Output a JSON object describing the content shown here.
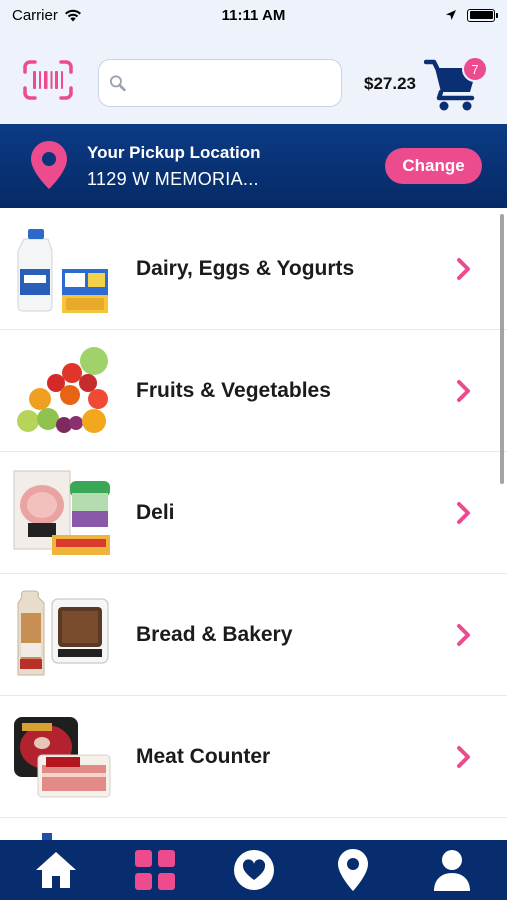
{
  "status_bar": {
    "carrier": "Carrier",
    "time": "11:11 AM"
  },
  "header": {
    "search_placeholder": "",
    "cart_total": "$27.23",
    "cart_count": "7"
  },
  "pickup": {
    "title": "Your Pickup Location",
    "address": "1129 W MEMORIA...",
    "change_label": "Change"
  },
  "categories": [
    {
      "label": "Dairy, Eggs & Yogurts",
      "icon": "dairy-image"
    },
    {
      "label": "Fruits & Vegetables",
      "icon": "produce-image"
    },
    {
      "label": "Deli",
      "icon": "deli-image"
    },
    {
      "label": "Bread & Bakery",
      "icon": "bakery-image"
    },
    {
      "label": "Meat Counter",
      "icon": "meat-image"
    }
  ],
  "tabs": [
    {
      "icon": "home-icon",
      "active": false
    },
    {
      "icon": "categories-grid-icon",
      "active": true
    },
    {
      "icon": "favorites-heart-icon",
      "active": false
    },
    {
      "icon": "location-pin-icon",
      "active": false
    },
    {
      "icon": "account-person-icon",
      "active": false
    }
  ],
  "colors": {
    "accent": "#ec4b8e",
    "navy": "#072d6e",
    "header_bg": "#eef2fa"
  }
}
